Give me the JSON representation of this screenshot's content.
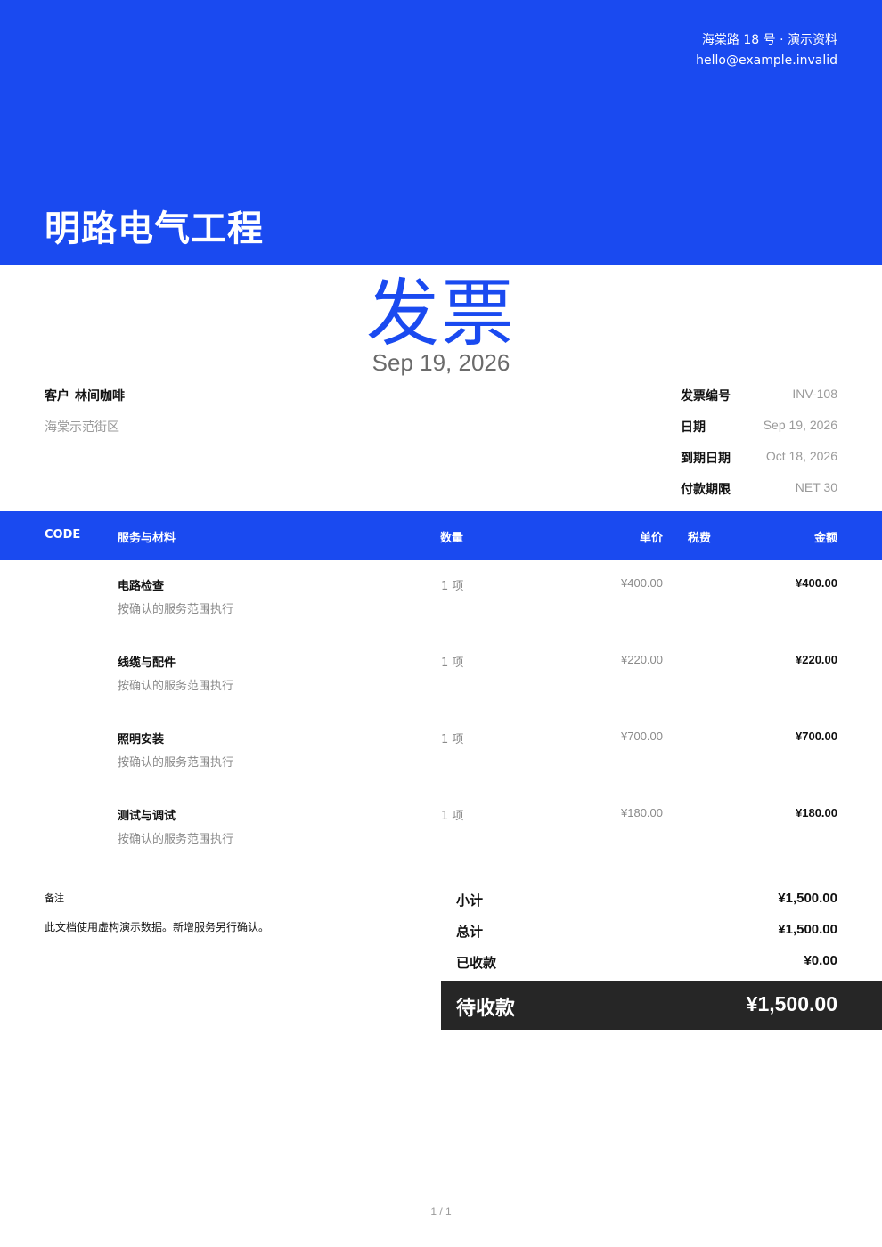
{
  "header": {
    "address": "海棠路 18 号 · 演示资料",
    "email": "hello@example.invalid",
    "company": "明路电气工程"
  },
  "document": {
    "title": "发票",
    "date": "Sep 19, 2026"
  },
  "client": {
    "label": "客户",
    "name": "林间咖啡",
    "address": "海棠示范街区"
  },
  "meta": [
    {
      "label": "发票编号",
      "value": "INV-108"
    },
    {
      "label": "日期",
      "value": "Sep 19, 2026"
    },
    {
      "label": "到期日期",
      "value": "Oct 18, 2026"
    },
    {
      "label": "付款期限",
      "value": "NET 30"
    }
  ],
  "table": {
    "headers": {
      "code": "CODE",
      "service": "服务与材料",
      "qty": "数量",
      "unit_price": "单价",
      "tax": "税费",
      "amount": "金额"
    },
    "rows": [
      {
        "name": "电路检查",
        "desc": "按确认的服务范围执行",
        "qty": "1 项",
        "unit_price": "¥400.00",
        "amount": "¥400.00"
      },
      {
        "name": "线缆与配件",
        "desc": "按确认的服务范围执行",
        "qty": "1 项",
        "unit_price": "¥220.00",
        "amount": "¥220.00"
      },
      {
        "name": "照明安装",
        "desc": "按确认的服务范围执行",
        "qty": "1 项",
        "unit_price": "¥700.00",
        "amount": "¥700.00"
      },
      {
        "name": "测试与调试",
        "desc": "按确认的服务范围执行",
        "qty": "1 项",
        "unit_price": "¥180.00",
        "amount": "¥180.00"
      }
    ]
  },
  "notes": {
    "label": "备注",
    "text": "此文档使用虚构演示数据。新增服务另行确认。"
  },
  "totals": [
    {
      "label": "小计",
      "value": "¥1,500.00"
    },
    {
      "label": "总计",
      "value": "¥1,500.00"
    },
    {
      "label": "已收款",
      "value": "¥0.00"
    }
  ],
  "balance_due": {
    "label": "待收款",
    "value": "¥1,500.00"
  },
  "pagination": "1 / 1",
  "colors": {
    "brand": "#1a4af0",
    "dark": "#262626"
  }
}
